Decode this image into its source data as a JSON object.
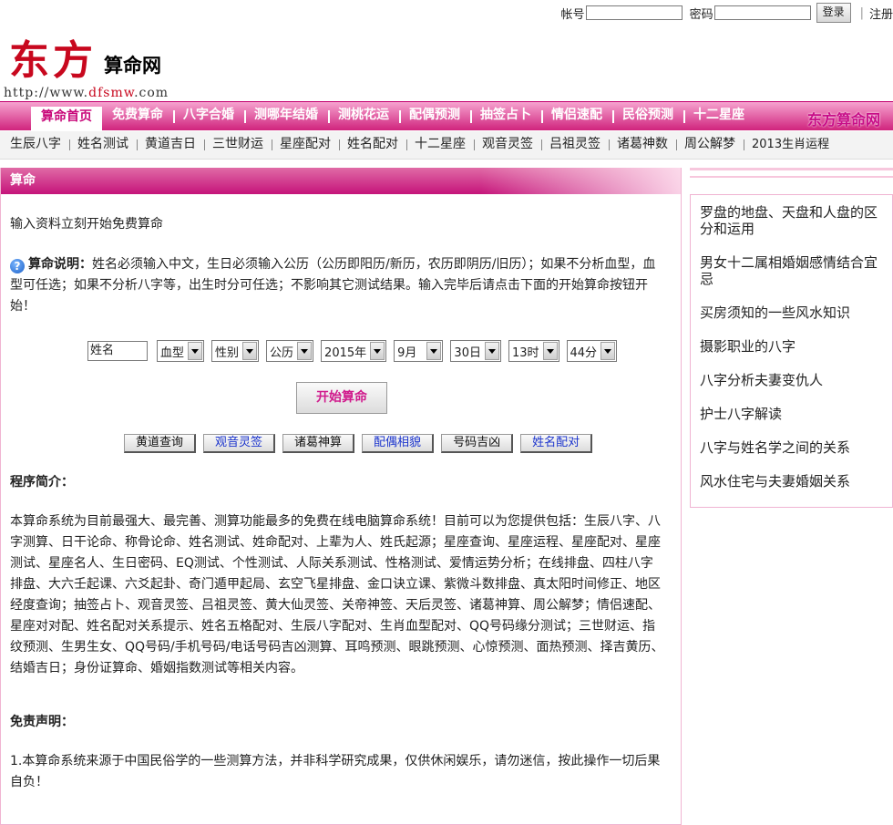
{
  "login": {
    "account_label": "帐号",
    "password_label": "密码",
    "login_btn": "登录",
    "register": "注册"
  },
  "logo": {
    "big": "东方",
    "small": "算命网",
    "url_prefix": "http://www.",
    "url_red": "dfsmw",
    "url_suffix": ".com"
  },
  "nav_main": {
    "items": [
      "算命首页",
      "免费算命",
      "八字合婚",
      "测哪年结婚",
      "测桃花运",
      "配偶预测",
      "抽签占卜",
      "情侣速配",
      "民俗预测",
      "十二星座"
    ],
    "brand": "东方算命网"
  },
  "nav_sub": {
    "items": [
      "生辰八字",
      "姓名测试",
      "黄道吉日",
      "三世财运",
      "星座配对",
      "姓名配对",
      "十二星座",
      "观音灵签",
      "吕祖灵签",
      "诸葛神数",
      "周公解梦",
      "2013生肖运程"
    ]
  },
  "panel": {
    "title": "算命",
    "intro": "输入资料立刻开始免费算命",
    "desc_label": "算命说明：",
    "desc_text": "姓名必须输入中文，生日必须输入公历（公历即阳历/新历，农历即阴历/旧历）；如果不分析血型，血型可任选；如果不分析八字等，出生时分可任选；不影响其它测试结果。输入完毕后请点击下面的开始算命按钮开始！",
    "form": {
      "name_value": "姓名",
      "blood": "血型",
      "gender": "性别",
      "calendar": "公历",
      "year": "2015年",
      "month": "9月",
      "day": "30日",
      "hour": "13时",
      "minute": "44分"
    },
    "start_btn": "开始算命",
    "tools": [
      "黄道查询",
      "观音灵签",
      "诸葛神算",
      "配偶相貌",
      "号码吉凶",
      "姓名配对"
    ],
    "program_title": "程序简介：",
    "program_text": "本算命系统为目前最强大、最完善、测算功能最多的免费在线电脑算命系统！目前可以为您提供包括：生辰八字、八字测算、日干论命、称骨论命、姓名测试、姓命配对、上辈为人、姓氏起源；星座查询、星座运程、星座配对、星座测试、星座名人、生日密码、EQ测试、个性测试、人际关系测试、性格测试、爱情运势分析；在线排盘、四柱八字排盘、大六壬起课、六爻起卦、奇门遁甲起局、玄空飞星排盘、金口诀立课、紫微斗数排盘、真太阳时间修正、地区经度查询；抽签占卜、观音灵签、吕祖灵签、黄大仙灵签、关帝神签、天后灵签、诸葛神算、周公解梦；情侣速配、星座对对配、姓名配对关系提示、姓名五格配对、生辰八字配对、生肖血型配对、QQ号码缘分测试；三世财运、指纹预测、生男生女、QQ号码/手机号码/电话号码吉凶测算、耳鸣预测、眼跳预测、心惊预测、面热预测、择吉黄历、结婚吉日；身份证算命、婚姻指数测试等相关内容。",
    "disclaimer_title": "免责声明：",
    "disclaimer_text": "1.本算命系统来源于中国民俗学的一些测算方法，并非科学研究成果，仅供休闲娱乐，请勿迷信，按此操作一切后果自负！"
  },
  "sidebar": {
    "articles": [
      "罗盘的地盘、天盘和人盘的区分和运用",
      "男女十二属相婚姻感情结合宜忌",
      "买房须知的一些风水知识",
      "摄影职业的八字",
      "八字分析夫妻变仇人",
      "护士八字解读",
      "八字与姓名学之间的关系",
      "风水住宅与夫妻婚姻关系"
    ]
  }
}
